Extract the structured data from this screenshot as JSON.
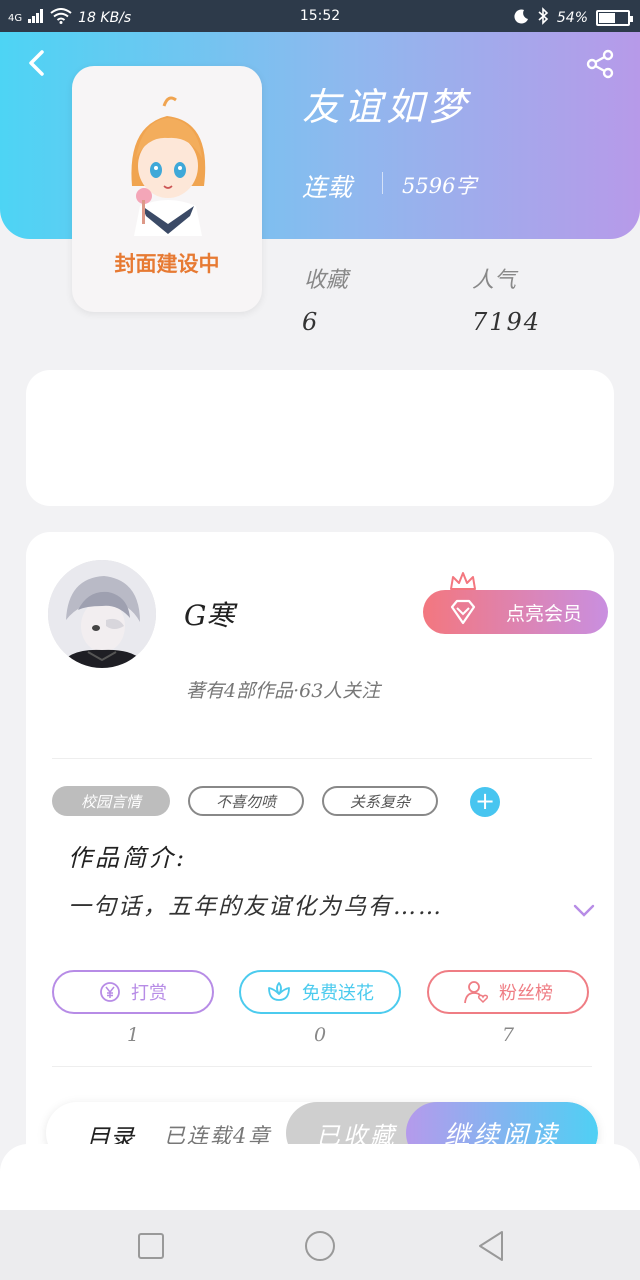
{
  "status_bar": {
    "network": "4G",
    "speed": "18 KB/s",
    "time": "15:52",
    "battery": "54%",
    "battery_level": 0.54
  },
  "header": {
    "back_icon": "chevron-left-icon",
    "share_icon": "share-icon",
    "cover_text": "封面建设中",
    "title": "友谊如梦",
    "status": "连载",
    "word_count": "5596字"
  },
  "stats": [
    {
      "label": "收藏",
      "value": "6"
    },
    {
      "label": "人气",
      "value": "7194"
    }
  ],
  "author": {
    "name": "G寒",
    "meta": "著有4部作品·63人关注",
    "vip_label": "点亮会员"
  },
  "tags": [
    "校园言情",
    "不喜勿喷",
    "关系复杂"
  ],
  "intro": {
    "label": "作品简介:",
    "text": "一句话，五年的友谊化为乌有……"
  },
  "actions": [
    {
      "label": "打赏",
      "count": "1",
      "color": "#b78ce6",
      "icon": "yuan-coin-icon"
    },
    {
      "label": "免费送花",
      "count": "0",
      "color": "#4ccbee",
      "icon": "flower-icon"
    },
    {
      "label": "粉丝榜",
      "count": "7",
      "color": "#ef7d84",
      "icon": "fan-user-icon"
    }
  ],
  "bottom_bar": {
    "toc": "目录",
    "chapters": "已连载4章",
    "favorite": "已收藏",
    "read": "继续阅读"
  },
  "colors": {
    "header_start": "#4dd4f4",
    "header_end": "#b79ae9",
    "accent_blue": "#47c5f0",
    "cover_text": "#e77a33"
  }
}
